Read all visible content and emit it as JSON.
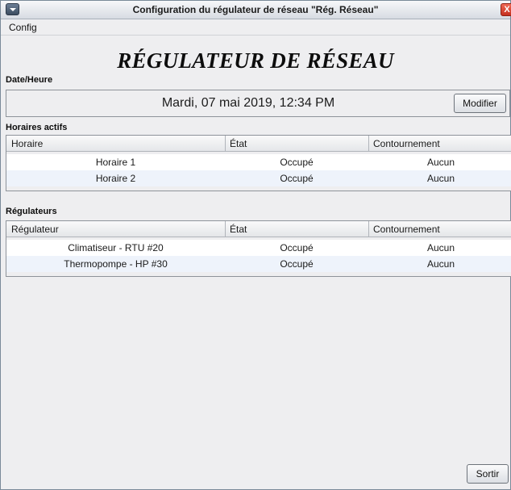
{
  "window": {
    "title": "Configuration du régulateur de réseau \"Rég. Réseau\"",
    "close_glyph": "X"
  },
  "menu": {
    "items": [
      {
        "label": "Config"
      }
    ]
  },
  "app_title": "RÉGULATEUR DE RÉSEAU",
  "datetime": {
    "section_label": "Date/Heure",
    "value": "Mardi, 07 mai 2019, 12:34 PM",
    "modify_label": "Modifier"
  },
  "schedules": {
    "section_label": "Horaires actifs",
    "columns": [
      "Horaire",
      "État",
      "Contournement"
    ],
    "rows": [
      [
        "Horaire 1",
        "Occupé",
        "Aucun"
      ],
      [
        "Horaire 2",
        "Occupé",
        "Aucun"
      ]
    ]
  },
  "regulators": {
    "section_label": "Régulateurs",
    "columns": [
      "Régulateur",
      "État",
      "Contournement"
    ],
    "rows": [
      [
        "Climatiseur - RTU #20",
        "Occupé",
        "Aucun"
      ],
      [
        "Thermopompe - HP #30",
        "Occupé",
        "Aucun"
      ]
    ]
  },
  "footer": {
    "exit_label": "Sortir"
  },
  "colors": {
    "row_alt": "#eef3fb",
    "background": "#eeeef0",
    "close_red": "#d9412c"
  }
}
